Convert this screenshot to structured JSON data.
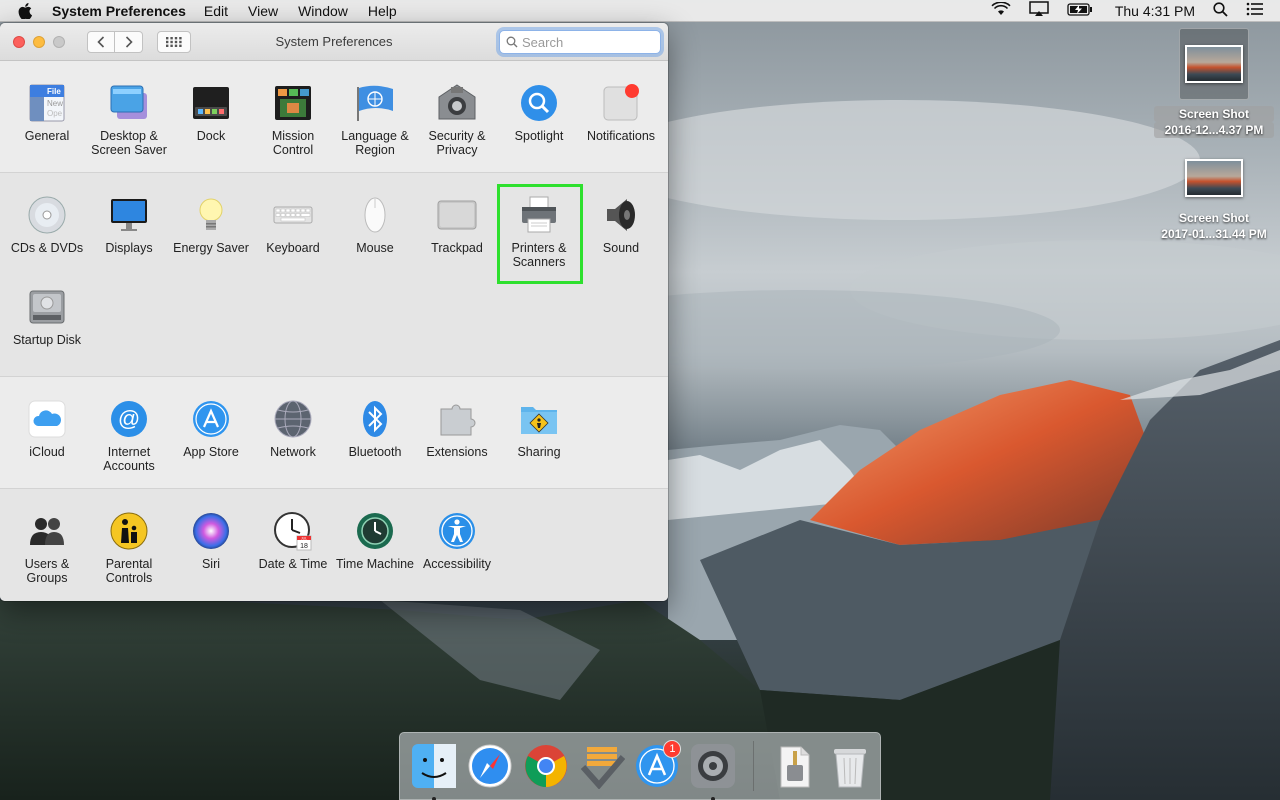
{
  "menubar": {
    "app_name": "System Preferences",
    "menus": [
      "Edit",
      "View",
      "Window",
      "Help"
    ],
    "clock": "Thu 4:31 PM"
  },
  "window": {
    "title": "System Preferences",
    "search_placeholder": "Search"
  },
  "sections": {
    "personal": [
      {
        "label": "General"
      },
      {
        "label": "Desktop & Screen Saver"
      },
      {
        "label": "Dock"
      },
      {
        "label": "Mission Control"
      },
      {
        "label": "Language & Region"
      },
      {
        "label": "Security & Privacy"
      },
      {
        "label": "Spotlight"
      },
      {
        "label": "Notifications"
      }
    ],
    "hardware": [
      {
        "label": "CDs & DVDs"
      },
      {
        "label": "Displays"
      },
      {
        "label": "Energy Saver"
      },
      {
        "label": "Keyboard"
      },
      {
        "label": "Mouse"
      },
      {
        "label": "Trackpad"
      },
      {
        "label": "Printers & Scanners"
      },
      {
        "label": "Sound"
      },
      {
        "label": "Startup Disk"
      }
    ],
    "internet": [
      {
        "label": "iCloud"
      },
      {
        "label": "Internet Accounts"
      },
      {
        "label": "App Store"
      },
      {
        "label": "Network"
      },
      {
        "label": "Bluetooth"
      },
      {
        "label": "Extensions"
      },
      {
        "label": "Sharing"
      }
    ],
    "system": [
      {
        "label": "Users & Groups"
      },
      {
        "label": "Parental Controls"
      },
      {
        "label": "Siri"
      },
      {
        "label": "Date & Time"
      },
      {
        "label": "Time Machine"
      },
      {
        "label": "Accessibility"
      }
    ]
  },
  "desktop_icons": [
    {
      "name": "Screen Shot",
      "sub": "2016-12...4.37 PM"
    },
    {
      "name": "Screen Shot",
      "sub": "2017-01...31.44 PM"
    }
  ],
  "dock": {
    "items": [
      "finder-icon",
      "safari-icon",
      "chrome-icon",
      "omnifocus-icon",
      "app-store-icon",
      "system-preferences-icon",
      "archive-icon",
      "trash-icon"
    ],
    "app_store_badge": "1"
  },
  "calendar_icon": {
    "month": "JUL",
    "day": "18"
  },
  "colors": {
    "highlight": "#2ee02e",
    "badge": "#ff3b30"
  }
}
